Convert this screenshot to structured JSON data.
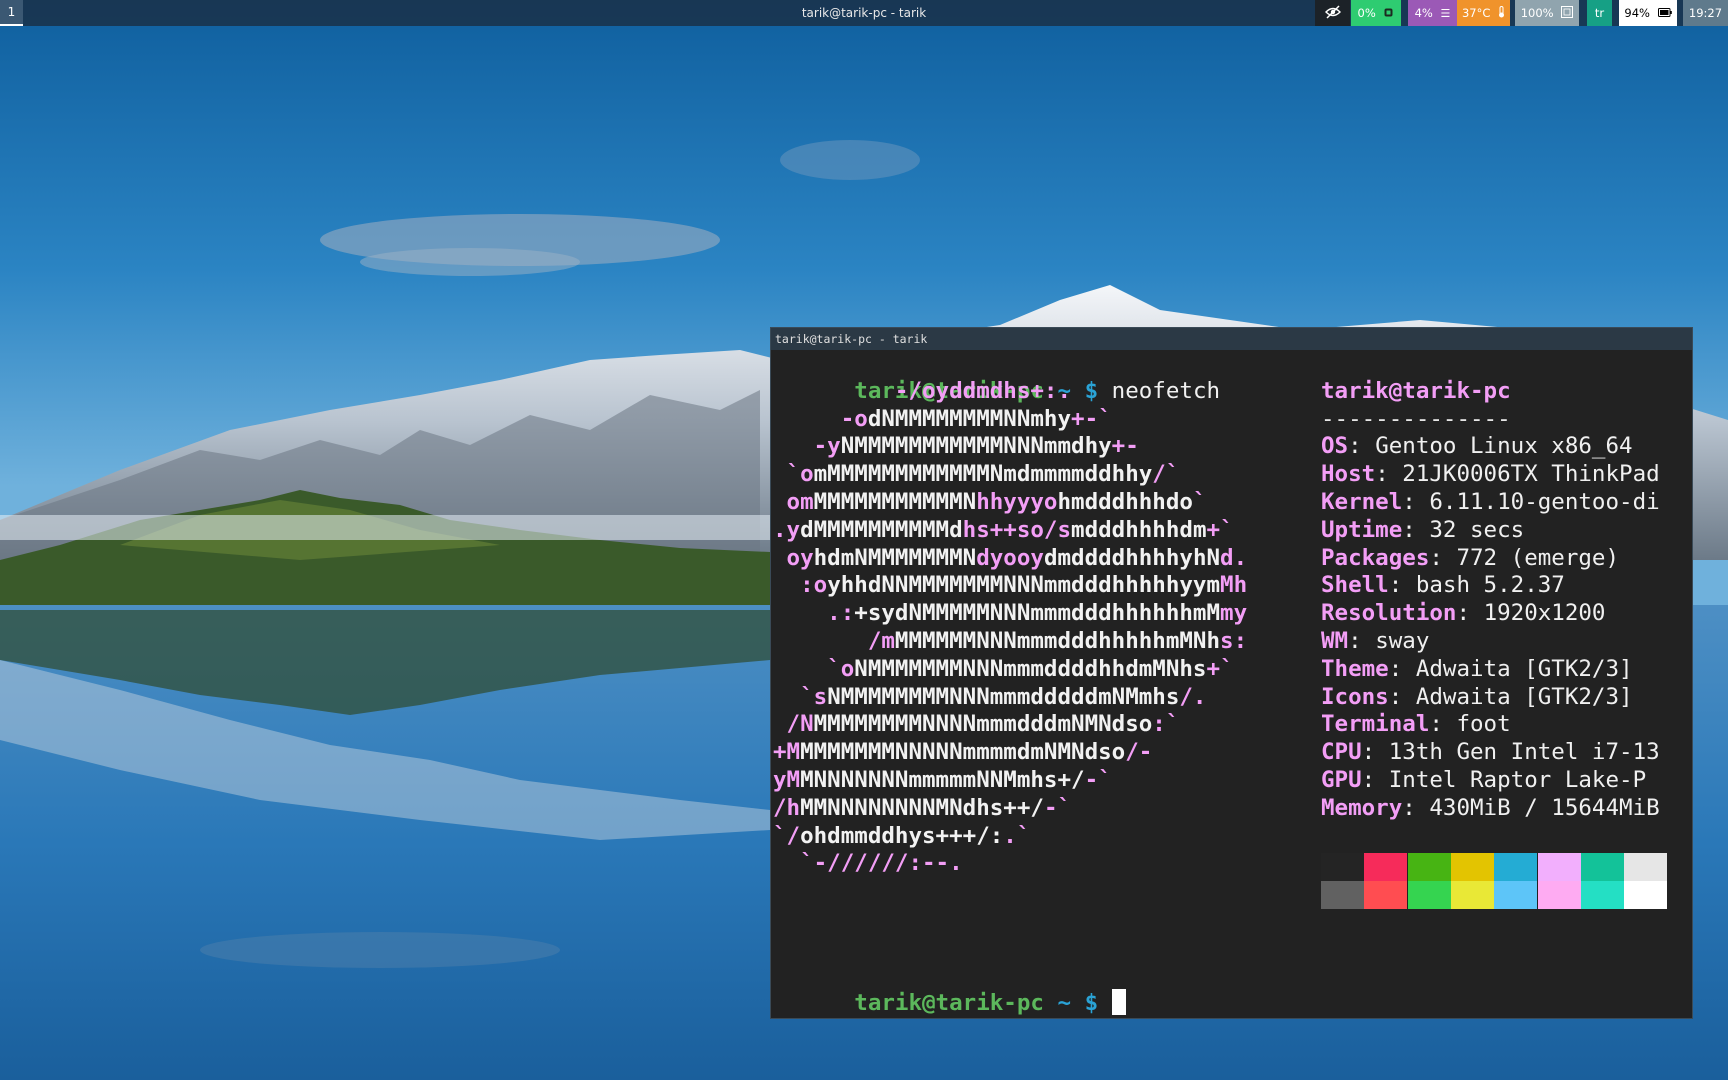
{
  "topbar": {
    "workspace": "1",
    "window_title": "tarik@tarik-pc - tarik",
    "modules": {
      "privacy_icon": "eye-slash-icon",
      "cpu": "0%",
      "cpu_icon": "cpu-chip-icon",
      "memory": "4%",
      "memory_icon": "menu-lines-icon",
      "temperature": "37°C",
      "temperature_icon": "thermometer-icon",
      "brightness": "100%",
      "brightness_icon": "display-icon",
      "language": "tr",
      "battery": "94%",
      "battery_icon": "battery-icon",
      "clock": "19:27"
    }
  },
  "terminal": {
    "title": "tarik@tarik-pc - tarik",
    "prompt": {
      "user_host": "tarik@tarik-pc",
      "tilde": "~",
      "dollar": "$"
    },
    "command": "neofetch",
    "logo_lines": [
      [
        [
          "p",
          "         -/oyddmdhs+:."
        ]
      ],
      [
        [
          "p",
          "     -o"
        ],
        [
          "w",
          "dNMMMMMMMMNNmhy"
        ],
        [
          "p",
          "+-`"
        ]
      ],
      [
        [
          "p",
          "   -y"
        ],
        [
          "w",
          "NMMMMMMMMMMMNNNmmdhy"
        ],
        [
          "p",
          "+-"
        ]
      ],
      [
        [
          "p",
          " `o"
        ],
        [
          "w",
          "mMMMMMMMMMMMMNmdmmmmddhhy"
        ],
        [
          "p",
          "/`"
        ]
      ],
      [
        [
          "p",
          " om"
        ],
        [
          "w",
          "MMMMMMMMMMMN"
        ],
        [
          "p",
          "hhyyyo"
        ],
        [
          "w",
          "hmdddhhhdo"
        ],
        [
          "p",
          "`"
        ]
      ],
      [
        [
          "p",
          ".y"
        ],
        [
          "w",
          "dMMMMMMMMMMd"
        ],
        [
          "p",
          "hs++so/s"
        ],
        [
          "w",
          "mdddhhhhdm"
        ],
        [
          "p",
          "+`"
        ]
      ],
      [
        [
          "p",
          " oy"
        ],
        [
          "w",
          "hdmNMMMMMMMN"
        ],
        [
          "p",
          "dyooy"
        ],
        [
          "w",
          "dmddddhhhhyhN"
        ],
        [
          "p",
          "d."
        ]
      ],
      [
        [
          "p",
          "  :o"
        ],
        [
          "w",
          "yhhdNNMMMMMMMNNNmmdddhhhhhyym"
        ],
        [
          "p",
          "Mh"
        ]
      ],
      [
        [
          "p",
          "    .:"
        ],
        [
          "w",
          "+sydNMMMMMNNNmmmdddhhhhhhmM"
        ],
        [
          "p",
          "my"
        ]
      ],
      [
        [
          "p",
          "       /m"
        ],
        [
          "w",
          "MMMMMMNNNmmmdddhhhhhmMNh"
        ],
        [
          "p",
          "s:"
        ]
      ],
      [
        [
          "p",
          "    `o"
        ],
        [
          "w",
          "NMMMMMMMNNNmmmddddhhdmMNhs"
        ],
        [
          "p",
          "+`"
        ]
      ],
      [
        [
          "p",
          "  `s"
        ],
        [
          "w",
          "NMMMMMMMMNNNmmmdddddmNMmhs"
        ],
        [
          "p",
          "/."
        ]
      ],
      [
        [
          "p",
          " /N"
        ],
        [
          "w",
          "MMMMMMMMNNNNmmmdddmNMNdso"
        ],
        [
          "p",
          ":`"
        ]
      ],
      [
        [
          "p",
          "+M"
        ],
        [
          "w",
          "MMMMMMMNNNNNmmmmdmNMNdso"
        ],
        [
          "p",
          "/-"
        ]
      ],
      [
        [
          "p",
          "yM"
        ],
        [
          "w",
          "MNNNNNNNmmmmmNNMmhs+/"
        ],
        [
          "p",
          "-`"
        ]
      ],
      [
        [
          "p",
          "/h"
        ],
        [
          "w",
          "MMNNNNNNNNMNdhs++/"
        ],
        [
          "p",
          "-`"
        ]
      ],
      [
        [
          "p",
          "`/"
        ],
        [
          "w",
          "ohdmmddhys+++/:"
        ],
        [
          "p",
          ".`"
        ]
      ],
      [
        [
          "p",
          "  `-//////:--."
        ]
      ]
    ],
    "info": {
      "user_host": "tarik@tarik-pc",
      "separator": "--------------",
      "rows": [
        {
          "key": "OS",
          "value": "Gentoo Linux x86_64"
        },
        {
          "key": "Host",
          "value": "21JK0006TX ThinkPad"
        },
        {
          "key": "Kernel",
          "value": "6.11.10-gentoo-di"
        },
        {
          "key": "Uptime",
          "value": "32 secs"
        },
        {
          "key": "Packages",
          "value": "772 (emerge)"
        },
        {
          "key": "Shell",
          "value": "bash 5.2.37"
        },
        {
          "key": "Resolution",
          "value": "1920x1200"
        },
        {
          "key": "WM",
          "value": "sway"
        },
        {
          "key": "Theme",
          "value": "Adwaita [GTK2/3]"
        },
        {
          "key": "Icons",
          "value": "Adwaita [GTK2/3]"
        },
        {
          "key": "Terminal",
          "value": "foot"
        },
        {
          "key": "CPU",
          "value": "13th Gen Intel i7-13"
        },
        {
          "key": "GPU",
          "value": "Intel Raptor Lake-P"
        },
        {
          "key": "Memory",
          "value": "430MiB / 15644MiB"
        }
      ]
    },
    "palette": {
      "normal": [
        "#242424",
        "#f62b5a",
        "#47b413",
        "#e3c401",
        "#24acd4",
        "#f2affd",
        "#13c299",
        "#e6e6e6"
      ],
      "bright": [
        "#616161",
        "#ff4d51",
        "#35d450",
        "#e9e836",
        "#5dc5f8",
        "#feabf2",
        "#24dfc4",
        "#ffffff"
      ]
    }
  }
}
